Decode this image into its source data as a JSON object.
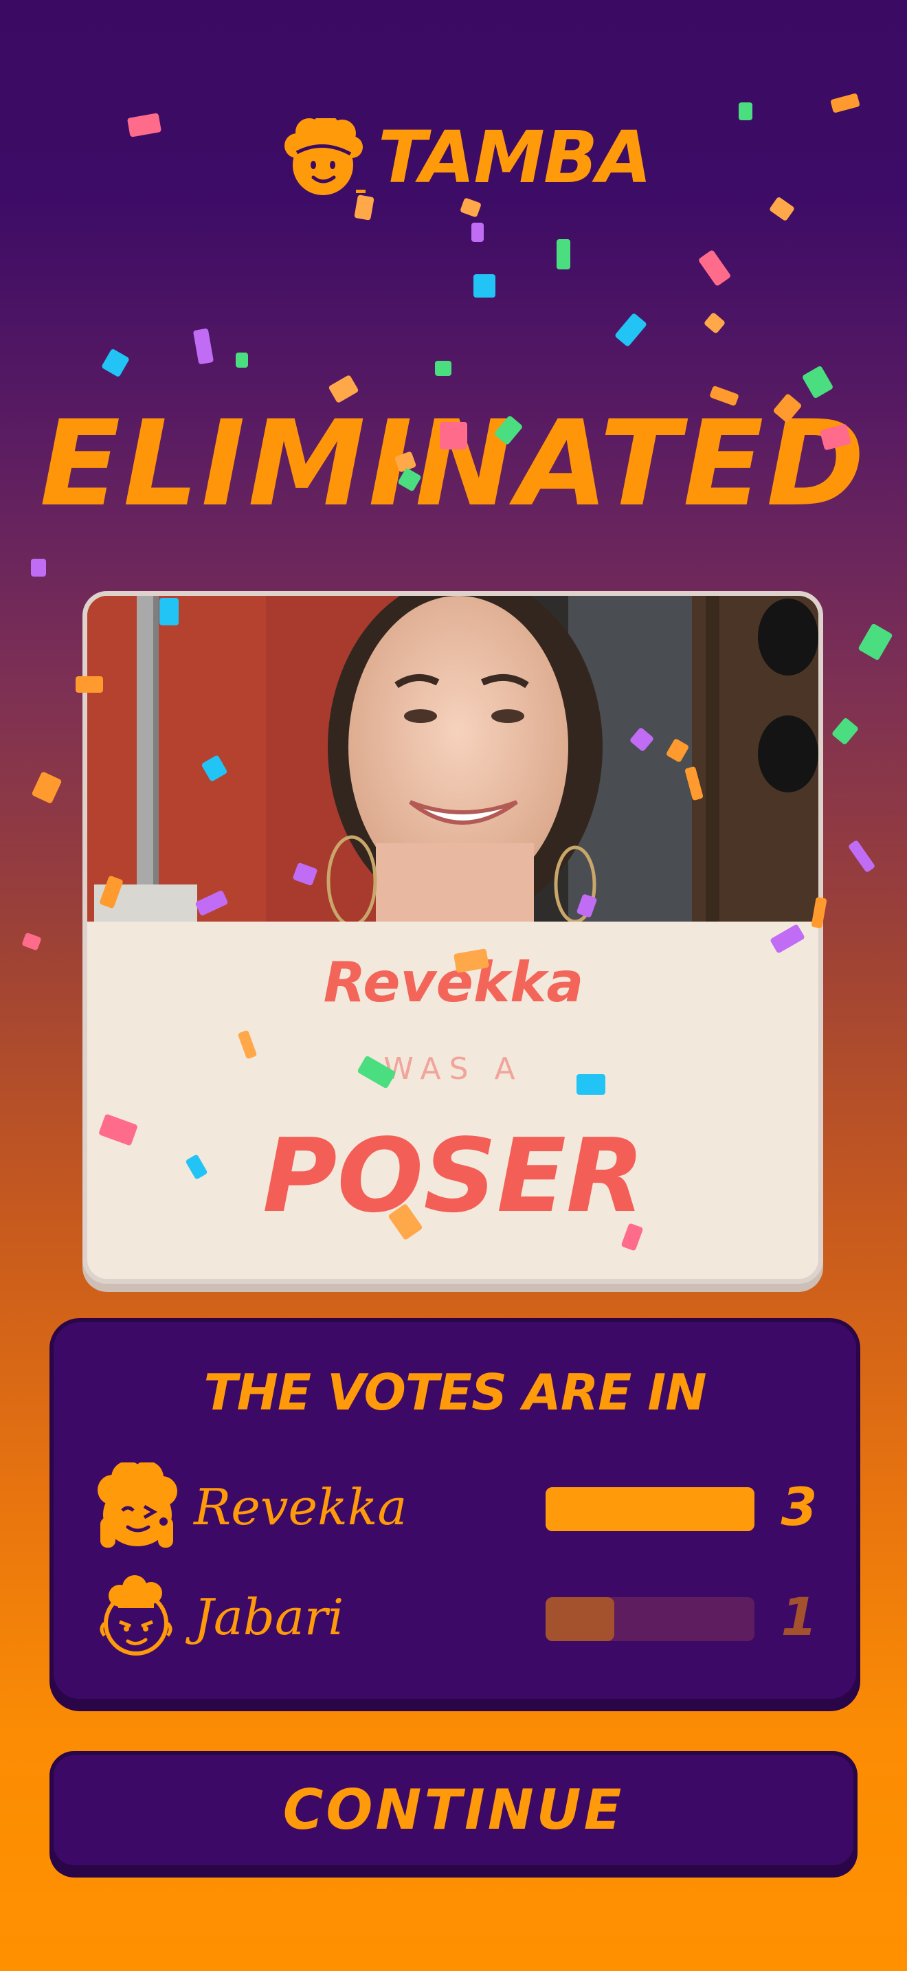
{
  "app": {
    "name": "TAMBA"
  },
  "headline": "ELIMINATED",
  "card": {
    "player_name": "Revekka",
    "was_a": "WAS A",
    "role": "POSER"
  },
  "votes": {
    "title": "THE VOTES ARE IN",
    "rows": [
      {
        "name": "Revekka",
        "count": "3",
        "fraction": 1.0,
        "color": "#ff9a0a",
        "track": "#ff9a0a"
      },
      {
        "name": "Jabari",
        "count": "1",
        "fraction": 0.33,
        "color": "#a4522e",
        "track": "#5d1d5f"
      }
    ]
  },
  "continue_label": "CONTINUE",
  "colors": {
    "accent": "#ff9a0a",
    "panel": "#3c0a66",
    "card_text": "#f26558"
  },
  "icons": [
    "tamba-logo-icon",
    "revekka-avatar-icon",
    "jabari-avatar-icon"
  ]
}
